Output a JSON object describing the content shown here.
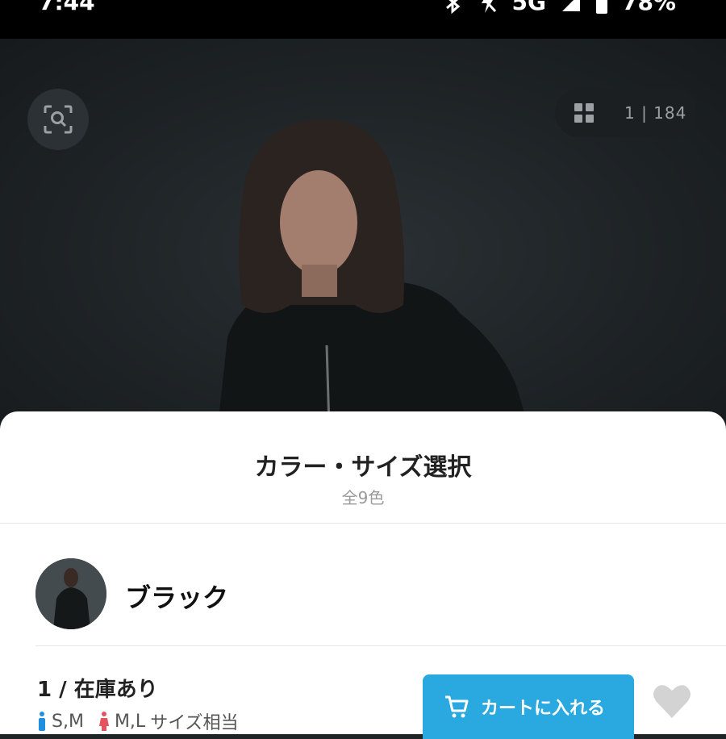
{
  "status_bar": {
    "time": "7:44",
    "network": "5G",
    "battery": "78%"
  },
  "gallery": {
    "counter": "1 | 184"
  },
  "sheet": {
    "title": "カラー・サイズ選択",
    "subtitle": "全9色"
  },
  "color_option": {
    "name": "ブラック"
  },
  "size_row": {
    "stock": "1 / 在庫あり",
    "male_size": "S,M",
    "female_size": "M,L",
    "suffix": "サイズ相当"
  },
  "cart": {
    "label": "カートに入れる"
  },
  "colors": {
    "accent": "#29a9e0",
    "male_icon": "#1f8fe0",
    "female_icon": "#e05560"
  }
}
